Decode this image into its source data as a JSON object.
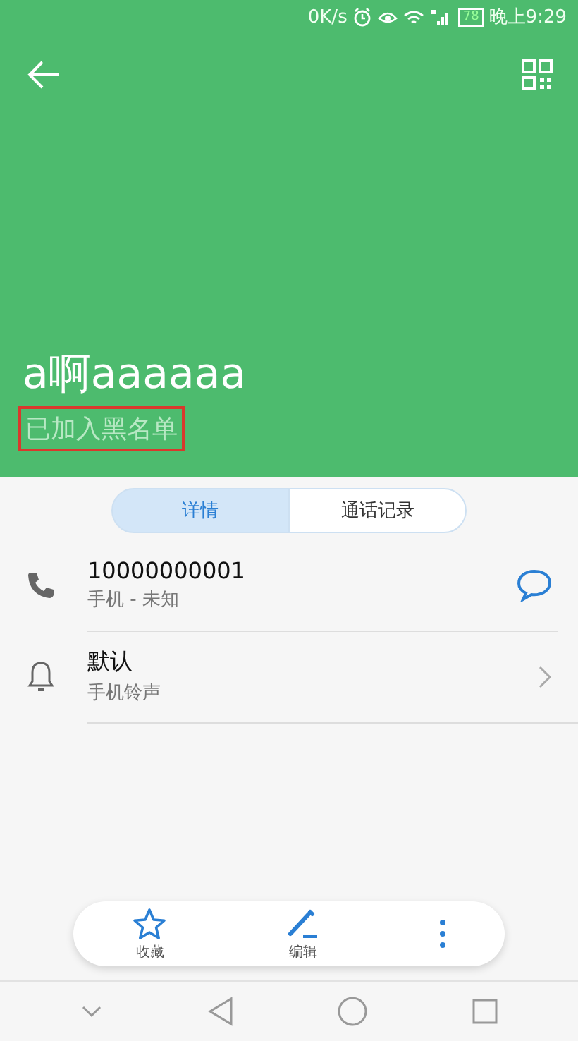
{
  "status_bar": {
    "speed": "0K/s",
    "battery": "78",
    "time": "晚上9:29"
  },
  "contact": {
    "name": "a啊aaaaaa",
    "blocked_label": "已加入黑名单",
    "blocked_label_highlighted": true
  },
  "tabs": [
    {
      "label": "详情",
      "selected": true
    },
    {
      "label": "通话记录",
      "selected": false
    }
  ],
  "details": [
    {
      "kind": "phone",
      "title": "10000000001",
      "subtitle": "手机 - 未知"
    },
    {
      "kind": "ringtone",
      "title": "默认",
      "subtitle": "手机铃声"
    }
  ],
  "actions": [
    {
      "kind": "favorite",
      "label": "收藏"
    },
    {
      "kind": "edit",
      "label": "编辑"
    },
    {
      "kind": "more"
    }
  ]
}
